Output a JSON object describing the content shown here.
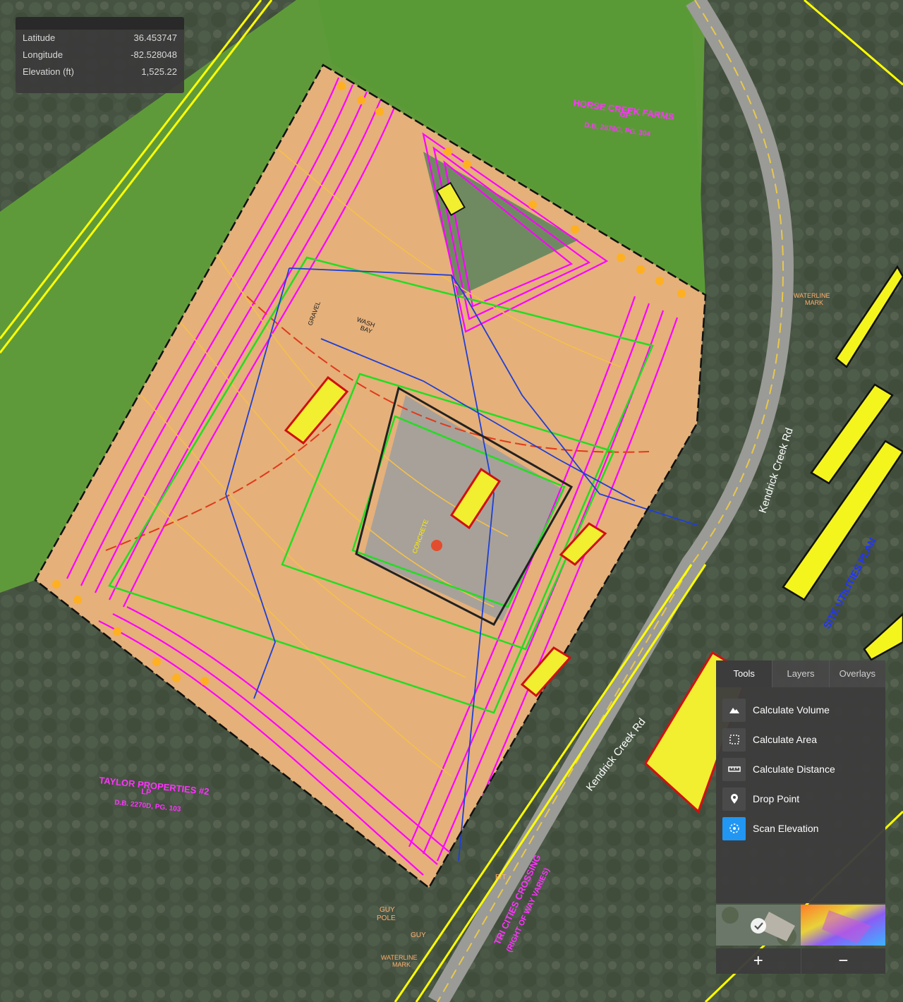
{
  "coords": {
    "latitude_label": "Latitude",
    "latitude_value": "36.453747",
    "longitude_label": "Longitude",
    "longitude_value": "-82.528048",
    "elevation_label": "Elevation (ft)",
    "elevation_value": "1,525.22"
  },
  "map_labels": {
    "road_1": "Kendrick Creek Rd",
    "road_2": "Kendrick Creek Rd",
    "horse_creek": [
      "HORSE CREEK FARMS",
      "GP",
      "D.B. 2876C, PG. 304"
    ],
    "taylor": [
      "TAYLOR PROPERTIES #2",
      "LP",
      "D.B. 2270D, PG. 103"
    ],
    "site_utilities": "SITE UTILITIES PLAN",
    "tri_cities": [
      "TRI CITIES CROSSING",
      "(RIGHT OF WAY VARIES)"
    ],
    "guy_pole": [
      "GUY",
      "POLE"
    ],
    "guy": "GUY",
    "waterline_mark_1": [
      "WATERLINE",
      "MARK"
    ],
    "waterline_mark_2": [
      "WATERLINE",
      "MARK"
    ],
    "wash_bay": [
      "WASH",
      "BAY"
    ],
    "concrete": "CONCRETE",
    "gravel": "GRAVEL",
    "et": "E/T"
  },
  "panel": {
    "tabs": [
      "Tools",
      "Layers",
      "Overlays"
    ],
    "active_tab": "Tools",
    "tools": [
      {
        "label": "Calculate Volume",
        "icon": "mountain-icon"
      },
      {
        "label": "Calculate Area",
        "icon": "area-icon"
      },
      {
        "label": "Calculate Distance",
        "icon": "ruler-icon"
      },
      {
        "label": "Drop Point",
        "icon": "map-pin-icon"
      },
      {
        "label": "Scan Elevation",
        "icon": "scan-elevation-icon",
        "active": true
      }
    ],
    "zoom_in": "+",
    "zoom_out": "−"
  },
  "colors": {
    "accent": "#2196f3",
    "contour_major": "#ff00ff",
    "contour_minor": "#f5c04a",
    "boundary_green": "#22dd22",
    "utility_blue": "#1f3fd6",
    "annotation_yellow": "#ffff00"
  }
}
